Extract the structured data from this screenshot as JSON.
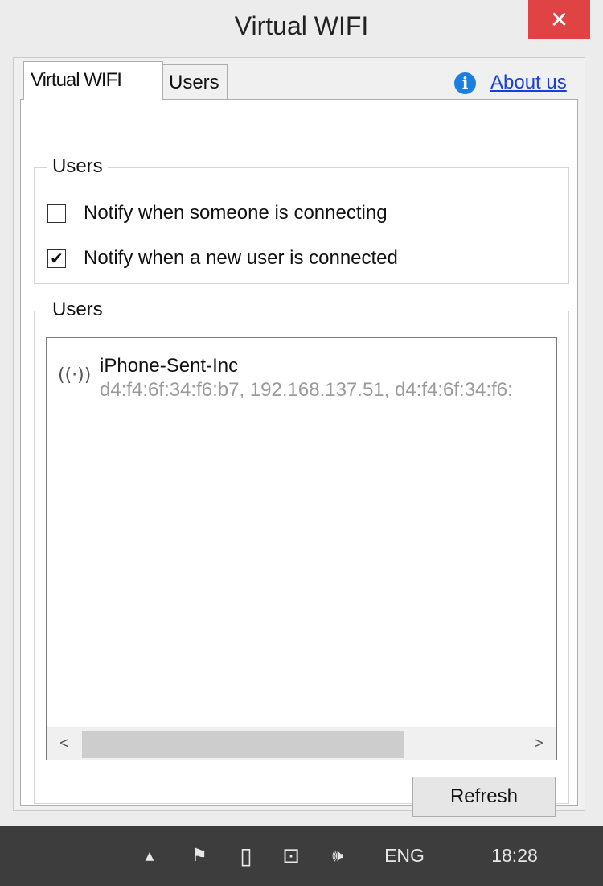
{
  "window": {
    "title": "Virtual WIFI",
    "close_glyph": "✕"
  },
  "tabs": [
    {
      "label": "Virtual WIFI",
      "active": true
    },
    {
      "label": "Users",
      "active": false
    }
  ],
  "about": {
    "icon": "info-icon",
    "icon_glyph": "i",
    "label": "About us"
  },
  "notifications_group": {
    "legend": "Users",
    "options": [
      {
        "label": "Notify when someone is connecting",
        "checked": false,
        "glyph": ""
      },
      {
        "label": "Notify when a new user is connected",
        "checked": true,
        "glyph": "✔"
      }
    ]
  },
  "users_group": {
    "legend": "Users",
    "users": [
      {
        "icon": "wifi-signal-icon",
        "icon_glyph": "((·))",
        "name": "iPhone-Sent-Inc",
        "details": "d4:f4:6f:34:f6:b7, 192.168.137.51, d4:f4:6f:34:f6:"
      }
    ],
    "scroll_left_glyph": "<",
    "scroll_right_glyph": ">",
    "refresh_label": "Refresh"
  },
  "taskbar": {
    "tray_up_glyph": "▲",
    "flag_glyph": "⚑",
    "battery_glyph": "▯",
    "network_glyph": "⊡",
    "volume_glyph": "🕪",
    "language": "ENG",
    "time": "18:28"
  },
  "colors": {
    "close_button": "#e04343",
    "link": "#1a3fd6",
    "info_icon": "#1a7fde",
    "taskbar": "#3d3d3d"
  }
}
